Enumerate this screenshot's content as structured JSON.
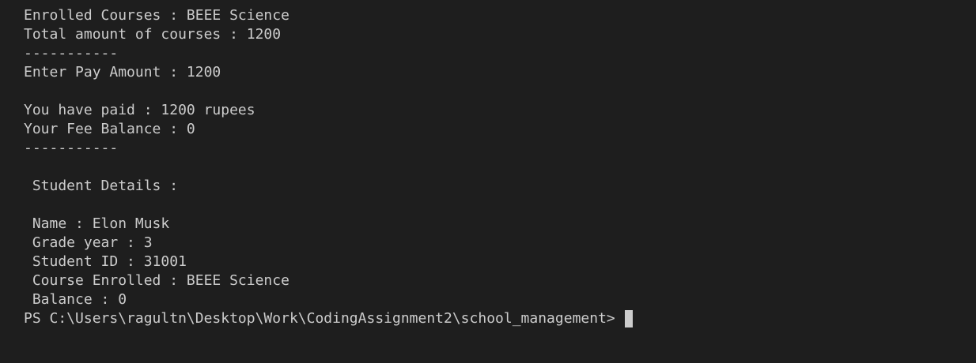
{
  "terminal": {
    "lines": [
      "Enrolled Courses : BEEE Science",
      "Total amount of courses : 1200",
      "-----------",
      "Enter Pay Amount : 1200",
      "",
      "You have paid : 1200 rupees",
      "Your Fee Balance : 0",
      "-----------",
      "",
      " Student Details :",
      "",
      " Name : Elon Musk",
      " Grade year : 3",
      " Student ID : 31001",
      " Course Enrolled : BEEE Science",
      " Balance : 0"
    ],
    "prompt": "PS C:\\Users\\ragultn\\Desktop\\Work\\CodingAssignment2\\school_management>"
  },
  "colors": {
    "background": "#1e1e1e",
    "foreground": "#cccccc"
  }
}
